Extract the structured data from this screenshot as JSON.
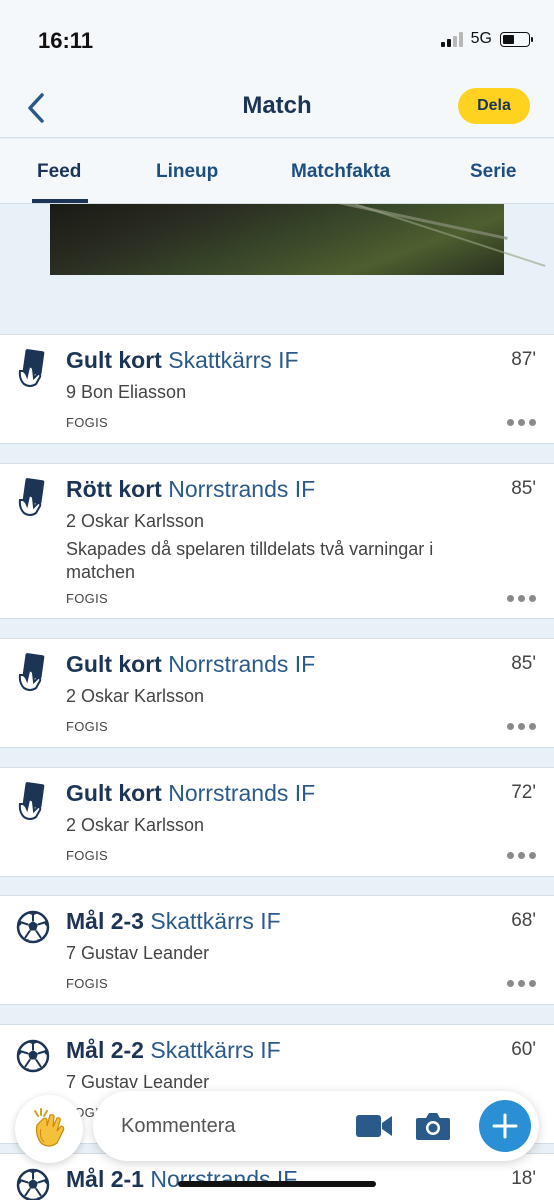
{
  "status": {
    "time": "16:11",
    "network": "5G"
  },
  "header": {
    "title": "Match",
    "share_label": "Dela"
  },
  "tabs": [
    {
      "label": "Feed",
      "active": true
    },
    {
      "label": "Lineup",
      "active": false
    },
    {
      "label": "Matchfakta",
      "active": false
    },
    {
      "label": "Serie",
      "active": false
    }
  ],
  "events": [
    {
      "type": "Gult kort",
      "team": "Skattkärrs IF",
      "minute": "87'",
      "player": "9 Bon Eliasson",
      "desc": "",
      "source": "FOGIS",
      "icon": "yellow-card-icon"
    },
    {
      "type": "Rött kort",
      "team": "Norrstrands IF",
      "minute": "85'",
      "player": "2 Oskar Karlsson",
      "desc": "Skapades då spelaren tilldelats två varningar i matchen",
      "source": "FOGIS",
      "icon": "red-card-icon"
    },
    {
      "type": "Gult kort",
      "team": "Norrstrands IF",
      "minute": "85'",
      "player": "2 Oskar Karlsson",
      "desc": "",
      "source": "FOGIS",
      "icon": "yellow-card-icon"
    },
    {
      "type": "Gult kort",
      "team": "Norrstrands IF",
      "minute": "72'",
      "player": "2 Oskar Karlsson",
      "desc": "",
      "source": "FOGIS",
      "icon": "yellow-card-icon"
    },
    {
      "type": "Mål 2-3",
      "team": "Skattkärrs IF",
      "minute": "68'",
      "player": "7 Gustav Leander",
      "desc": "",
      "source": "FOGIS",
      "icon": "football-icon"
    },
    {
      "type": "Mål 2-2",
      "team": "Skattkärrs IF",
      "minute": "60'",
      "player": "7 Gustav Leander",
      "desc": "",
      "source": "FOGIS",
      "icon": "football-icon"
    },
    {
      "type": "Mål 2-1",
      "team": "Norrstrands IF",
      "minute": "18'",
      "player": "",
      "desc": "",
      "source": "",
      "icon": "football-icon"
    }
  ],
  "comment": {
    "placeholder": "Kommentera"
  },
  "colors": {
    "primary": "#1c3557",
    "accent_yellow": "#ffd21f",
    "accent_blue": "#2b8fd6",
    "feed_background": "#e8f1f7"
  }
}
